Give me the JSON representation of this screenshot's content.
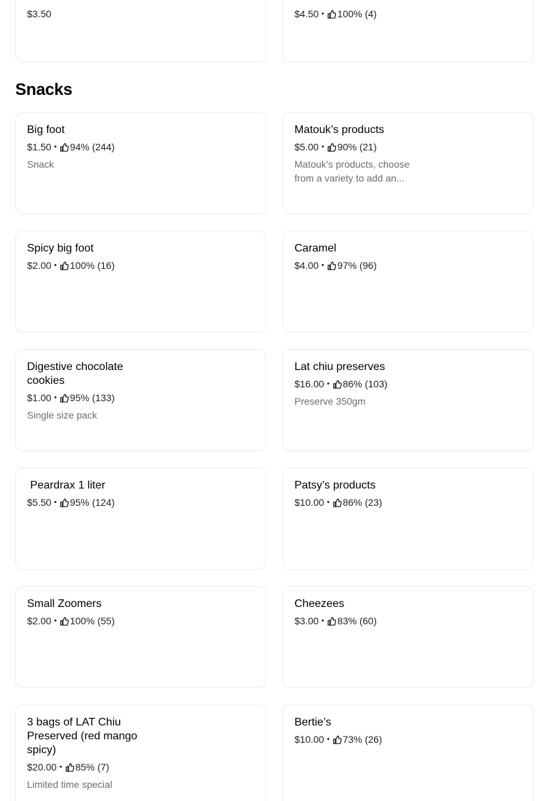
{
  "top_cards": [
    {
      "price": "$3.50",
      "rating": "",
      "reviews": ""
    },
    {
      "price": "$4.50",
      "rating": "100%",
      "reviews": "(4)"
    }
  ],
  "section": {
    "title": "Snacks"
  },
  "items": [
    {
      "name": "Big foot",
      "price": "$1.50",
      "rating": "94%",
      "reviews": "(244)",
      "description": "Snack"
    },
    {
      "name": "Matouk’s products",
      "price": "$5.00",
      "rating": "90%",
      "reviews": "(21)",
      "description": "Matouk’s products, choose from a variety to add an..."
    },
    {
      "name": "Spicy big foot",
      "price": "$2.00",
      "rating": "100%",
      "reviews": "(16)",
      "description": ""
    },
    {
      "name": "Caramel",
      "price": "$4.00",
      "rating": "97%",
      "reviews": "(96)",
      "description": ""
    },
    {
      "name": "Digestive chocolate cookies",
      "price": "$1.00",
      "rating": "95%",
      "reviews": "(133)",
      "description": "Single size pack"
    },
    {
      "name": "Lat chiu preserves",
      "price": "$16.00",
      "rating": "86%",
      "reviews": "(103)",
      "description": "Preserve 350gm"
    },
    {
      "name": " Peardrax 1 liter",
      "price": "$5.50",
      "rating": "95%",
      "reviews": "(124)",
      "description": ""
    },
    {
      "name": "Patsy’s products",
      "price": "$10.00",
      "rating": "86%",
      "reviews": "(23)",
      "description": ""
    },
    {
      "name": "Small Zoomers",
      "price": "$2.00",
      "rating": "100%",
      "reviews": "(55)",
      "description": ""
    },
    {
      "name": "Cheezees",
      "price": "$3.00",
      "rating": "83%",
      "reviews": "(60)",
      "description": ""
    },
    {
      "name": "3 bags of LAT Chiu Preserved (red mango spicy)",
      "price": "$20.00",
      "rating": "85%",
      "reviews": "(7)",
      "description": "Limited time special"
    },
    {
      "name": "Bertie’s",
      "price": "$10.00",
      "rating": "73%",
      "reviews": "(26)",
      "description": ""
    }
  ],
  "separator": "•",
  "icons": {
    "rating": "thumbs-up-icon"
  }
}
